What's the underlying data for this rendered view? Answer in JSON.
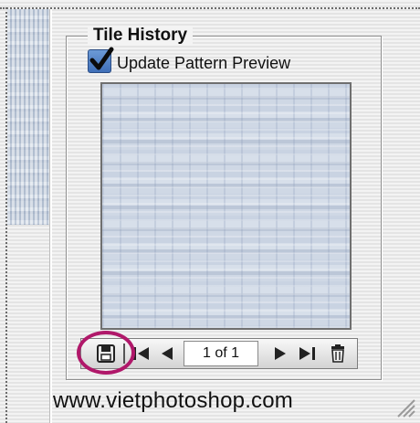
{
  "panel": {
    "group_title": "Tile History",
    "checkbox_label": "Update Pattern Preview",
    "checkbox_checked": true
  },
  "history": {
    "counter": "1 of 1"
  },
  "toolbar_icons": [
    "save-icon",
    "first-icon",
    "previous-icon",
    "next-icon",
    "last-icon",
    "trash-icon"
  ],
  "footer": {
    "watermark": "www.vietphotoshop.com"
  },
  "colors": {
    "accent_checkbox": "#4a7ac4",
    "highlight_ring": "#b0186a"
  }
}
